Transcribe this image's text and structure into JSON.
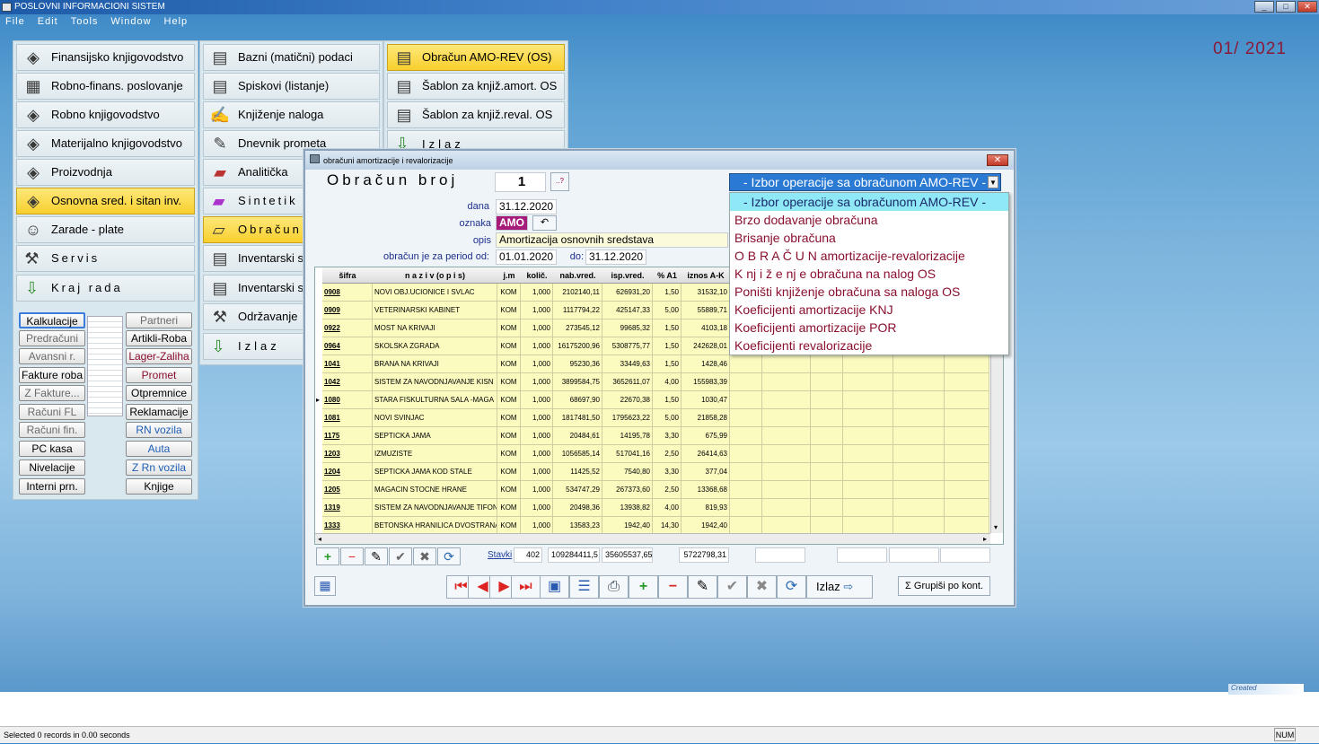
{
  "app": {
    "title": "POSLOVNI INFORMACIONI SISTEM",
    "period": "01/ 2021"
  },
  "menu": [
    "File",
    "Edit",
    "Tools",
    "Window",
    "Help"
  ],
  "col1": [
    "Finansijsko knjigovodstvo",
    "Robno-finans. poslovanje",
    "Robno knjigovodstvo",
    "Materijalno knjigovodstvo",
    "Proizvodnja",
    "Osnovna sred. i sitan inv.",
    "Zarade - plate",
    "Servis",
    "Kraj rada"
  ],
  "col2": [
    "Bazni (matični) podaci",
    "Spiskovi (listanje)",
    "Knjiženje naloga",
    "Dnevnik prometa",
    "Analitička",
    "Sintetik",
    "Obračun",
    "Inventarski s",
    "Inventarski s",
    "Održavanje",
    "Izlaz"
  ],
  "col3": [
    "Obračun  AMO-REV (OS)",
    "Šablon za knjiž.amort. OS",
    "Šablon za knjiž.reval. OS",
    "Izlaz"
  ],
  "small": {
    "left": [
      "Kalkulacije",
      "Predračuni",
      "Avansni r.",
      "Fakture roba",
      "Z Fakture...",
      "Računi FL",
      "Računi fin.",
      "PC kasa",
      "Nivelacije",
      "Interni prn."
    ],
    "right": [
      "Partneri",
      "Artikli-Roba",
      "Lager-Zaliha",
      "Promet",
      "Otpremnice",
      "Reklamacije",
      "RN vozila",
      "Auta",
      "Z Rn vozila",
      "Knjige"
    ]
  },
  "dialog": {
    "title": "obračuni amortizacije i revalorizacije",
    "heading": "Obračun broj",
    "number": "1",
    "help_btn": "..?",
    "dana_label": "dana",
    "dana": "31.12.2020",
    "oznaka_label": "oznaka",
    "oznaka": "AMO",
    "opis_label": "opis",
    "opis": "Amortizacija osnovnih sredstava",
    "period_label": "obračun je za period od:",
    "od": "01.01.2020",
    "do_label": "do:",
    "do": "31.12.2020",
    "columns": [
      "šifra",
      "n a z i v  (o p i s)",
      "j.m",
      "količ.",
      "nab.vred.",
      "isp.vred.",
      "% A1",
      "iznos A-K"
    ],
    "rows": [
      [
        "0908",
        "NOVI OBJ.UCIONICE I SVLAC",
        "KOM",
        "1,000",
        "2102140,11",
        "626931,20",
        "1,50",
        "31532,10"
      ],
      [
        "0909",
        "VETERINARSKI KABINET",
        "KOM",
        "1,000",
        "1117794,22",
        "425147,33",
        "5,00",
        "55889,71"
      ],
      [
        "0922",
        "MOST NA KRIVAJI",
        "KOM",
        "1,000",
        "273545,12",
        "99685,32",
        "1,50",
        "4103,18"
      ],
      [
        "0964",
        "SKOLSKA ZGRADA",
        "KOM",
        "1,000",
        "16175200,96",
        "5308775,77",
        "1,50",
        "242628,01"
      ],
      [
        "1041",
        "BRANA NA KRIVAJI",
        "KOM",
        "1,000",
        "95230,36",
        "33449,63",
        "1,50",
        "1428,46"
      ],
      [
        "1042",
        "SISTEM ZA NAVODNJAVANJE KISN",
        "KOM",
        "1,000",
        "3899584,75",
        "3652611,07",
        "4,00",
        "155983,39"
      ],
      [
        "1080",
        "STARA FISKULTURNA SALA -MAGA",
        "KOM",
        "1,000",
        "68697,90",
        "22670,38",
        "1,50",
        "1030,47"
      ],
      [
        "1081",
        "NOVI SVINJAC",
        "KOM",
        "1,000",
        "1817481,50",
        "1795623,22",
        "5,00",
        "21858,28"
      ],
      [
        "1175",
        "SEPTICKA JAMA",
        "KOM",
        "1,000",
        "20484,61",
        "14195,78",
        "3,30",
        "675,99"
      ],
      [
        "1203",
        "IZMUZISTE",
        "KOM",
        "1,000",
        "1056585,14",
        "517041,16",
        "2,50",
        "26414,63"
      ],
      [
        "1204",
        "SEPTICKA JAMA KOD STALE",
        "KOM",
        "1,000",
        "11425,52",
        "7540,80",
        "3,30",
        "377,04"
      ],
      [
        "1205",
        "MAGACIN STOCNE HRANE",
        "KOM",
        "1,000",
        "534747,29",
        "267373,60",
        "2,50",
        "13368,68"
      ],
      [
        "1319",
        "SISTEM ZA NAVODNJAVANJE TIFON",
        "KOM",
        "1,000",
        "20498,36",
        "13938,82",
        "4,00",
        "819,93"
      ],
      [
        "1333",
        "BETONSKA HRANILICA DVOSTRANA",
        "KOM",
        "1,000",
        "13583,23",
        "1942,40",
        "14,30",
        "1942,40"
      ]
    ],
    "totals": {
      "stavki_label": "Stavki",
      "stavki": "402",
      "nab": "109284411,5",
      "isp": "35605537,65",
      "iznos": "5722798,31"
    },
    "izlaz": "Izlaz",
    "grupisi": "Grupiši po kont.",
    "dropdown": {
      "selected": "- Izbor operacije sa obračunom AMO-REV -",
      "options": [
        "- Izbor operacije sa obračunom AMO-REV -",
        "Brzo dodavanje obračuna",
        "Brisanje obračuna",
        "O B R A Č U N   amortizacije-revalorizacije",
        "K nj i ž e nj e   obračuna na nalog OS",
        "Poništi knjiženje obračuna sa naloga OS",
        "Koeficijenti amortizacije KNJ",
        "Koeficijenti amortizacije POR",
        "Koeficijenti revalorizacije"
      ]
    }
  },
  "status": {
    "text": "Selected 0 records in 0.00 seconds",
    "num": "NUM",
    "logo": "Created"
  }
}
